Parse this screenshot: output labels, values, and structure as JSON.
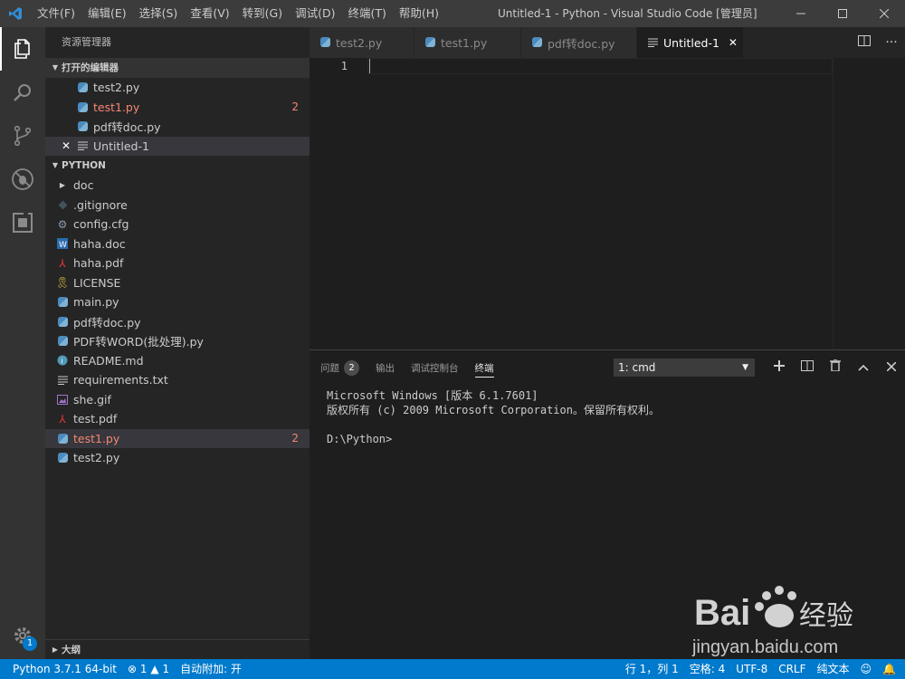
{
  "titlebar": {
    "menu": [
      "文件(F)",
      "编辑(E)",
      "选择(S)",
      "查看(V)",
      "转到(G)",
      "调试(D)",
      "终端(T)",
      "帮助(H)"
    ],
    "title": "Untitled-1 - Python - Visual Studio Code [管理员]"
  },
  "activitybar": {
    "items": [
      "explorer-icon",
      "search-icon",
      "source-control-icon",
      "debug-icon",
      "extensions-icon"
    ],
    "settings_badge": "1"
  },
  "sidebar": {
    "title": "资源管理器",
    "open_editors": {
      "header": "打开的编辑器",
      "items": [
        {
          "label": "test2.py",
          "icon": "python-icon"
        },
        {
          "label": "test1.py",
          "icon": "python-icon",
          "errors": "2"
        },
        {
          "label": "pdf转doc.py",
          "icon": "python-icon"
        },
        {
          "label": "Untitled-1",
          "icon": "text-file-icon"
        }
      ]
    },
    "folder": {
      "header": "PYTHON",
      "items": [
        {
          "label": "doc",
          "icon": "folder-chevron-icon"
        },
        {
          "label": ".gitignore",
          "icon": "gitignore-icon"
        },
        {
          "label": "config.cfg",
          "icon": "gear-file-icon"
        },
        {
          "label": "haha.doc",
          "icon": "word-file-icon"
        },
        {
          "label": "haha.pdf",
          "icon": "pdf-file-icon"
        },
        {
          "label": "LICENSE",
          "icon": "license-icon"
        },
        {
          "label": "main.py",
          "icon": "python-icon"
        },
        {
          "label": "pdf转doc.py",
          "icon": "python-icon"
        },
        {
          "label": "PDF转WORD(批处理).py",
          "icon": "python-icon"
        },
        {
          "label": "README.md",
          "icon": "info-file-icon"
        },
        {
          "label": "requirements.txt",
          "icon": "text-file-icon"
        },
        {
          "label": "she.gif",
          "icon": "image-file-icon"
        },
        {
          "label": "test.pdf",
          "icon": "pdf-file-icon"
        },
        {
          "label": "test1.py",
          "icon": "python-icon",
          "errors": "2"
        },
        {
          "label": "test2.py",
          "icon": "python-icon"
        }
      ]
    },
    "outline": "大纲"
  },
  "tabs": [
    {
      "label": "test2.py",
      "icon": "python-icon"
    },
    {
      "label": "test1.py",
      "icon": "python-icon"
    },
    {
      "label": "pdf转doc.py",
      "icon": "python-icon"
    },
    {
      "label": "Untitled-1",
      "icon": "text-file-icon",
      "active": true
    }
  ],
  "editor": {
    "line_numbers": [
      "1"
    ]
  },
  "panel": {
    "tabs": {
      "problems": "问题",
      "problems_count": "2",
      "output": "输出",
      "debug_console": "调试控制台",
      "terminal": "终端"
    },
    "terminal_select": "1: cmd",
    "terminal_lines": [
      "Microsoft Windows [版本 6.1.7601]",
      "版权所有 (c) 2009 Microsoft Corporation。保留所有权利。",
      "",
      "D:\\Python>"
    ]
  },
  "statusbar": {
    "interpreter": "Python 3.7.1 64-bit",
    "errors": "1",
    "warnings": "1",
    "auto_attach": "自动附加: 开",
    "cursor_pos": "行 1，列 1",
    "indent": "空格: 4",
    "encoding": "UTF-8",
    "eol": "CRLF",
    "language": "纯文本"
  },
  "watermark": {
    "brand": "Bai",
    "brand2": "经验",
    "url": "jingyan.baidu.com"
  },
  "colors": {
    "accent": "#007acc",
    "error": "#f48771"
  }
}
